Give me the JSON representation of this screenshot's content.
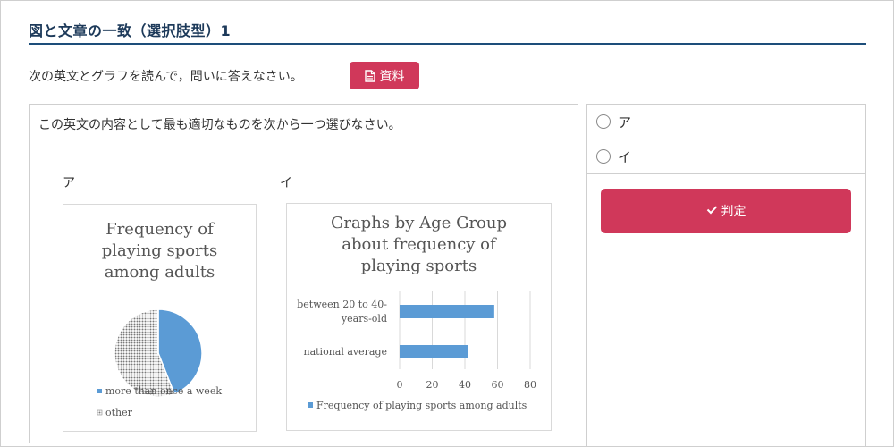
{
  "page": {
    "title": "図と文章の一致（選択肢型）1",
    "instruction": "次の英文とグラフを読んで，問いに答えなさい。",
    "doc_button_label": "資料",
    "question": "この英文の内容として最も適切なものを次から一つ選びなさい。",
    "option_labels": [
      "ア",
      "イ"
    ]
  },
  "answers": {
    "choices": [
      "ア",
      "イ"
    ],
    "judge_label": "判定"
  },
  "colors": {
    "accent": "#d0385a",
    "title": "#1d3a5a",
    "series_blue": "#5b9bd5"
  },
  "chart_data": [
    {
      "type": "pie",
      "title_lines": [
        "Frequency of",
        "playing sports",
        "among adults"
      ],
      "slices": [
        {
          "label": "more than once a week",
          "value": 44,
          "color": "#5b9bd5",
          "pattern": "solid"
        },
        {
          "label": "other",
          "value": 56,
          "color": "#9e9e9e",
          "pattern": "dotted"
        }
      ],
      "legend_position": "bottom"
    },
    {
      "type": "bar",
      "orientation": "horizontal",
      "title_lines": [
        "Graphs by Age Group",
        "about frequency of",
        "playing sports"
      ],
      "categories": [
        [
          "between 20 to 40-",
          "years-old"
        ],
        [
          "national average"
        ]
      ],
      "series": [
        {
          "name": "Frequency of playing sports among adults",
          "values": [
            58,
            42
          ],
          "color": "#5b9bd5"
        }
      ],
      "xlim": [
        0,
        80
      ],
      "xticks": [
        0,
        20,
        40,
        60,
        80
      ],
      "grid": true,
      "legend_position": "bottom"
    }
  ]
}
